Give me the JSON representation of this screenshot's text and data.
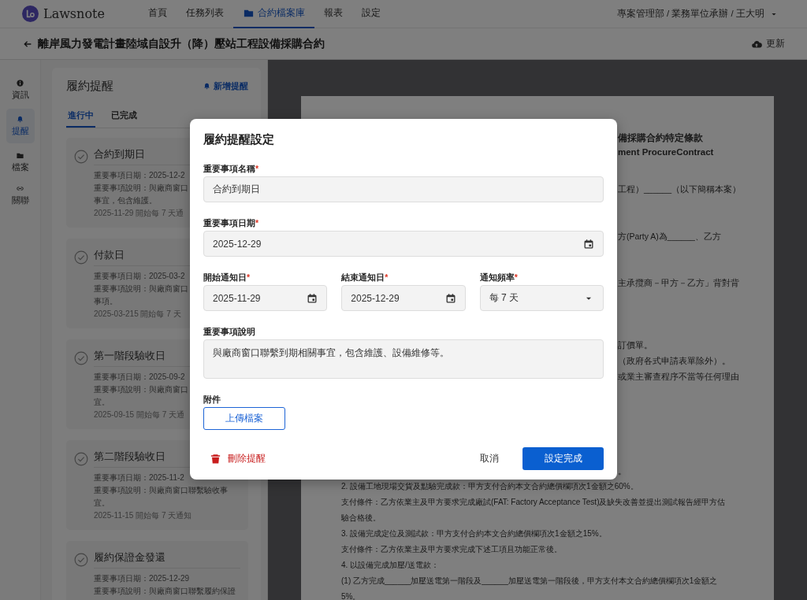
{
  "nav": {
    "logo": "Lawsnote",
    "items": [
      {
        "label": "首頁",
        "selected": false
      },
      {
        "label": "任務列表",
        "selected": false
      },
      {
        "label": "合約檔案庫",
        "selected": true
      },
      {
        "label": "報表",
        "selected": false
      },
      {
        "label": "設定",
        "selected": false
      }
    ],
    "user": "專案管理部 / 業務單位承辦 / 王大明"
  },
  "title_bar": {
    "title": "離岸風力發電計畫陸域自設升（降）壓站工程設備採購合約",
    "action": "更新"
  },
  "rail": [
    {
      "label": "資訊",
      "selected": false
    },
    {
      "label": "提醒",
      "selected": true
    },
    {
      "label": "檔案",
      "selected": false
    },
    {
      "label": "關聯",
      "selected": false
    }
  ],
  "reminders": {
    "title": "履約提醒",
    "add": "新增提醒",
    "tabs": [
      {
        "label": "進行中",
        "selected": true
      },
      {
        "label": "已完成",
        "selected": false
      }
    ],
    "items": [
      {
        "title": "合約到期日",
        "lines": [
          "重要事項日期：2025-12-2",
          "重要事項說明：與廠商窗口",
          "事宜，包含維護。",
          "2025-11-29 開始每 7 天通"
        ]
      },
      {
        "title": "付款日",
        "lines": [
          "重要事項日期：2025-03-2",
          "重要事項說明：與廠商窗口",
          "事項。",
          "2025-03-215 開始每 7 天"
        ]
      },
      {
        "title": "第一階段驗收日",
        "lines": [
          "重要事項日期：2025-09-2",
          "重要事項說明：與廠商窗口",
          "宜。",
          "2025-09-15 開始每 7 天通"
        ]
      },
      {
        "title": "第二階段驗收日",
        "lines": [
          "重要事項日期：2025-11-2",
          "重要事項說明：與廠商窗口聯繫驗收事",
          "宜。",
          "2025-11-15 開始每 7 天通知"
        ]
      },
      {
        "title": "履約保證金發還",
        "lines": [
          "重要事項日期：2025-12-29",
          "重要事項說明：與廠商窗口聯繫履約保證"
        ]
      }
    ]
  },
  "document": {
    "blocks": [
      {
        "kind": "heading",
        "lines": [
          "備採購合約特定條款",
          "ment ProcureContract"
        ]
      },
      {
        "kind": "fragment",
        "lines": [
          "工程）______（以下簡稱本案）"
        ]
      },
      {
        "kind": "fragment",
        "lines": [
          "方(Party A)為______、乙方"
        ]
      },
      {
        "kind": "fragment",
        "lines": [
          "主承攬商－甲方－乙方」背對背"
        ]
      },
      {
        "kind": "fragment",
        "lines": [
          "訂價單。",
          "（政府各式申請表單除外）。",
          "或業主審查程序不當等任何理由"
        ]
      },
      {
        "kind": "fragment",
        "lines": [
          "。"
        ]
      },
      {
        "kind": "body",
        "lines": [
          "2. 設備工地現場交貨及點驗完成款：甲方支付合約本文合約總價欄項次1金額之60%。",
          "支付條件：乙方依業主及甲方要求完成廠試(FAT: Factory Acceptance Test)及缺失改善並提出測試報告經甲方估",
          "驗合格後。",
          "3. 設備完成定位及測試款：甲方支付合約本文合約總價欄項次1金額之15%。",
          "支付條件：乙方依業主及甲方要求完成下述工項且功能正常後。",
          "4. 以設備完成加壓/送電款：",
          "(1) 乙方完成______加壓送電第一階段及______加壓送電第一階段後，甲方支付本文合約總價欄項次1金額之",
          "5%。"
        ]
      }
    ]
  },
  "dialog": {
    "title": "履約提醒設定",
    "rows": [
      [
        {
          "kind": "text",
          "label": "重要事項名稱",
          "required_mark": "*",
          "value": "合約到期日"
        }
      ],
      [
        {
          "kind": "date",
          "label": "重要事項日期",
          "required_mark": "*",
          "value": "2025-12-29"
        }
      ],
      [
        {
          "kind": "date",
          "label": "開始通知日",
          "required_mark": "*",
          "value": "2025-11-29"
        },
        {
          "kind": "date",
          "label": "結束通知日",
          "required_mark": "*",
          "value": "2025-12-29"
        },
        {
          "kind": "select",
          "label": "通知頻率",
          "required_mark": "*",
          "value": "每 7 天"
        }
      ],
      [
        {
          "kind": "textarea",
          "label": "重要事項說明",
          "value": "與廠商窗口聯繫到期相關事宜，包含維護、設備維修等。"
        }
      ]
    ],
    "attachment": {
      "label": "附件",
      "button": "上傳檔案"
    },
    "delete": "刪除提醒",
    "cancel": "取消",
    "confirm": "設定完成"
  }
}
